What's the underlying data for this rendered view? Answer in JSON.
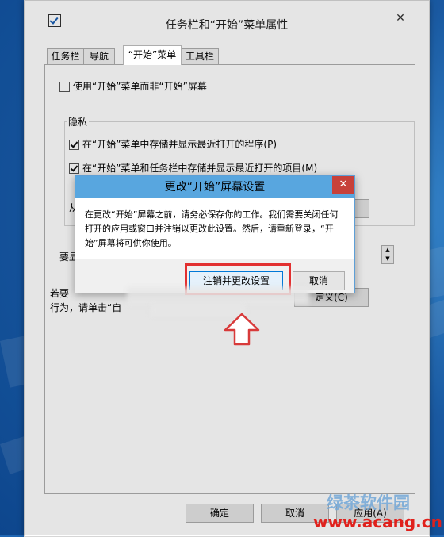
{
  "window": {
    "title": "任务栏和“开始”菜单属性",
    "close_glyph": "✕"
  },
  "tabs": [
    {
      "label": "任务栏",
      "active": false
    },
    {
      "label": "导航",
      "active": false
    },
    {
      "label": "“开始”菜单",
      "active": true
    },
    {
      "label": "工具栏",
      "active": false
    }
  ],
  "start_menu_tab": {
    "use_start_menu_label": "使用“开始”菜单而非“开始”屏幕",
    "use_start_menu_checked": false,
    "privacy": {
      "legend": "隐私",
      "store_programs_label": "在“开始”菜单中存储并显示最近打开的程序(P)",
      "store_programs_checked": true,
      "store_items_label": "在“开始”菜单和任务栏中存储并显示最近打开的项目(M)",
      "store_items_checked": true,
      "partial_text": "从"
    },
    "partial_label_1": "要显",
    "partial_label_2": "若要",
    "partial_label_3": "行为，请单击“自",
    "partial_button": "定义(C)"
  },
  "footer": {
    "ok_label": "确定",
    "cancel_label": "取消",
    "apply_label": "应用(A)"
  },
  "dialog": {
    "title": "更改“开始”屏幕设置",
    "close_glyph": "✕",
    "message": "在更改“开始”屏幕之前，请务必保存你的工作。我们需要关闭任何打开的应用或窗口并注销以更改此设置。然后，请重新登录，“开始”屏幕将可供你使用。",
    "primary_button": "注销并更改设置",
    "cancel_button": "取消"
  },
  "watermark": {
    "line1": "绿茶软件园",
    "line2": "www.acang.cn"
  },
  "colors": {
    "dialog_title_bg": "#58a6df",
    "dialog_close_bg": "#c7413a",
    "highlight": "#e23030",
    "desktop": "#1f66b3"
  }
}
